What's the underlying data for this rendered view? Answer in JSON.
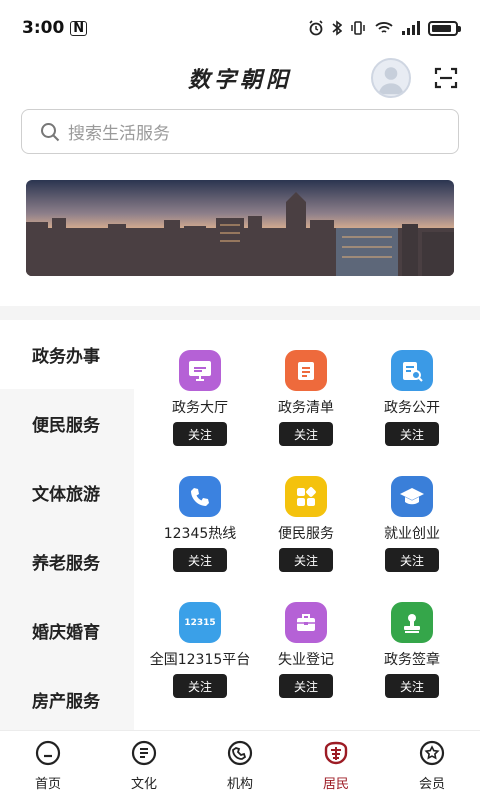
{
  "status_bar": {
    "time": "3:00",
    "nfc_glyph": "N",
    "battery_level": 0.85
  },
  "header": {
    "title": "数字朝阳",
    "avatar_icon": "user-avatar-icon",
    "scan_icon": "scan-icon"
  },
  "search": {
    "placeholder": "搜索生活服务"
  },
  "side_menu": {
    "active_index": 0,
    "items": [
      {
        "label": "政务办事"
      },
      {
        "label": "便民服务"
      },
      {
        "label": "文体旅游"
      },
      {
        "label": "养老服务"
      },
      {
        "label": "婚庆婚育"
      },
      {
        "label": "房产服务"
      }
    ]
  },
  "services": [
    {
      "label": "政务大厅",
      "follow": "关注",
      "icon": "monitor-icon",
      "color": "#b561d6"
    },
    {
      "label": "政务清单",
      "follow": "关注",
      "icon": "list-icon",
      "color": "#ee6a3c"
    },
    {
      "label": "政务公开",
      "follow": "关注",
      "icon": "doc-search-icon",
      "color": "#3b9ae6"
    },
    {
      "label": "12345热线",
      "follow": "关注",
      "icon": "phone-icon",
      "color": "#3b82e0"
    },
    {
      "label": "便民服务",
      "follow": "关注",
      "icon": "apps-icon",
      "color": "#f4c20d"
    },
    {
      "label": "就业创业",
      "follow": "关注",
      "icon": "graduation-icon",
      "color": "#3a7fd9"
    },
    {
      "label": "全国12315平台",
      "follow": "关注",
      "icon": "badge-12315-icon",
      "color": "#3aa0e8",
      "badge_text": "12315"
    },
    {
      "label": "失业登记",
      "follow": "关注",
      "icon": "briefcase-icon",
      "color": "#b561d6"
    },
    {
      "label": "政务签章",
      "follow": "关注",
      "icon": "stamp-icon",
      "color": "#35a64a"
    }
  ],
  "bottom_nav": {
    "active_index": 3,
    "accent": "#9c1b24",
    "items": [
      {
        "label": "首页",
        "icon": "home-icon"
      },
      {
        "label": "文化",
        "icon": "culture-icon"
      },
      {
        "label": "机构",
        "icon": "org-icon"
      },
      {
        "label": "居民",
        "icon": "resident-icon"
      },
      {
        "label": "会员",
        "icon": "member-icon"
      }
    ]
  }
}
